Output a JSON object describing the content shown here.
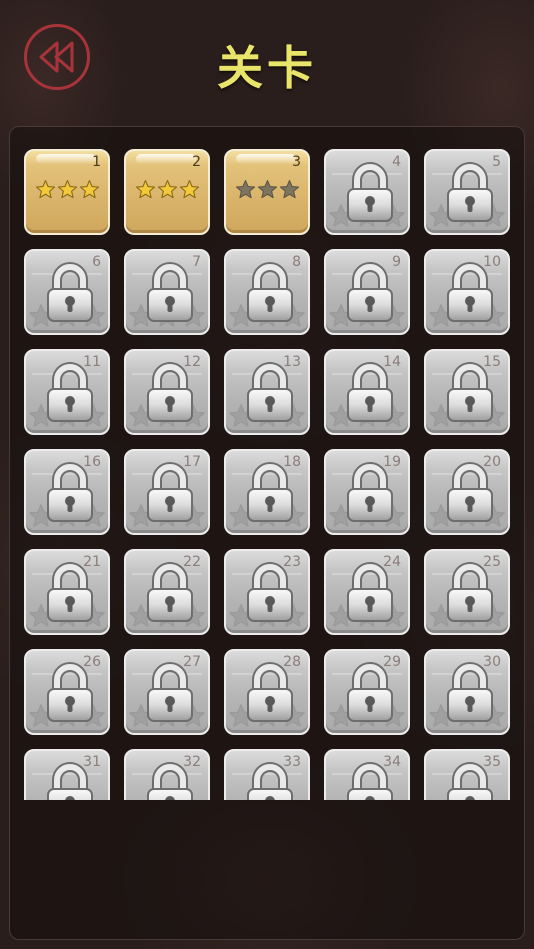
{
  "header": {
    "title": "关卡",
    "back_icon": "rewind-icon",
    "accent_color": "#a8343a",
    "title_color": "#e8e56a"
  },
  "levels": [
    {
      "number": "1",
      "locked": false,
      "stars": 3
    },
    {
      "number": "2",
      "locked": false,
      "stars": 3
    },
    {
      "number": "3",
      "locked": false,
      "stars": 0
    },
    {
      "number": "4",
      "locked": true
    },
    {
      "number": "5",
      "locked": true
    },
    {
      "number": "6",
      "locked": true
    },
    {
      "number": "7",
      "locked": true
    },
    {
      "number": "8",
      "locked": true
    },
    {
      "number": "9",
      "locked": true
    },
    {
      "number": "10",
      "locked": true
    },
    {
      "number": "11",
      "locked": true
    },
    {
      "number": "12",
      "locked": true
    },
    {
      "number": "13",
      "locked": true
    },
    {
      "number": "14",
      "locked": true
    },
    {
      "number": "15",
      "locked": true
    },
    {
      "number": "16",
      "locked": true
    },
    {
      "number": "17",
      "locked": true
    },
    {
      "number": "18",
      "locked": true
    },
    {
      "number": "19",
      "locked": true
    },
    {
      "number": "20",
      "locked": true
    },
    {
      "number": "21",
      "locked": true
    },
    {
      "number": "22",
      "locked": true
    },
    {
      "number": "23",
      "locked": true
    },
    {
      "number": "24",
      "locked": true
    },
    {
      "number": "25",
      "locked": true
    },
    {
      "number": "26",
      "locked": true
    },
    {
      "number": "27",
      "locked": true
    },
    {
      "number": "28",
      "locked": true
    },
    {
      "number": "29",
      "locked": true
    },
    {
      "number": "30",
      "locked": true
    },
    {
      "number": "31",
      "locked": true
    },
    {
      "number": "32",
      "locked": true
    },
    {
      "number": "33",
      "locked": true
    },
    {
      "number": "34",
      "locked": true
    },
    {
      "number": "35",
      "locked": true
    }
  ]
}
